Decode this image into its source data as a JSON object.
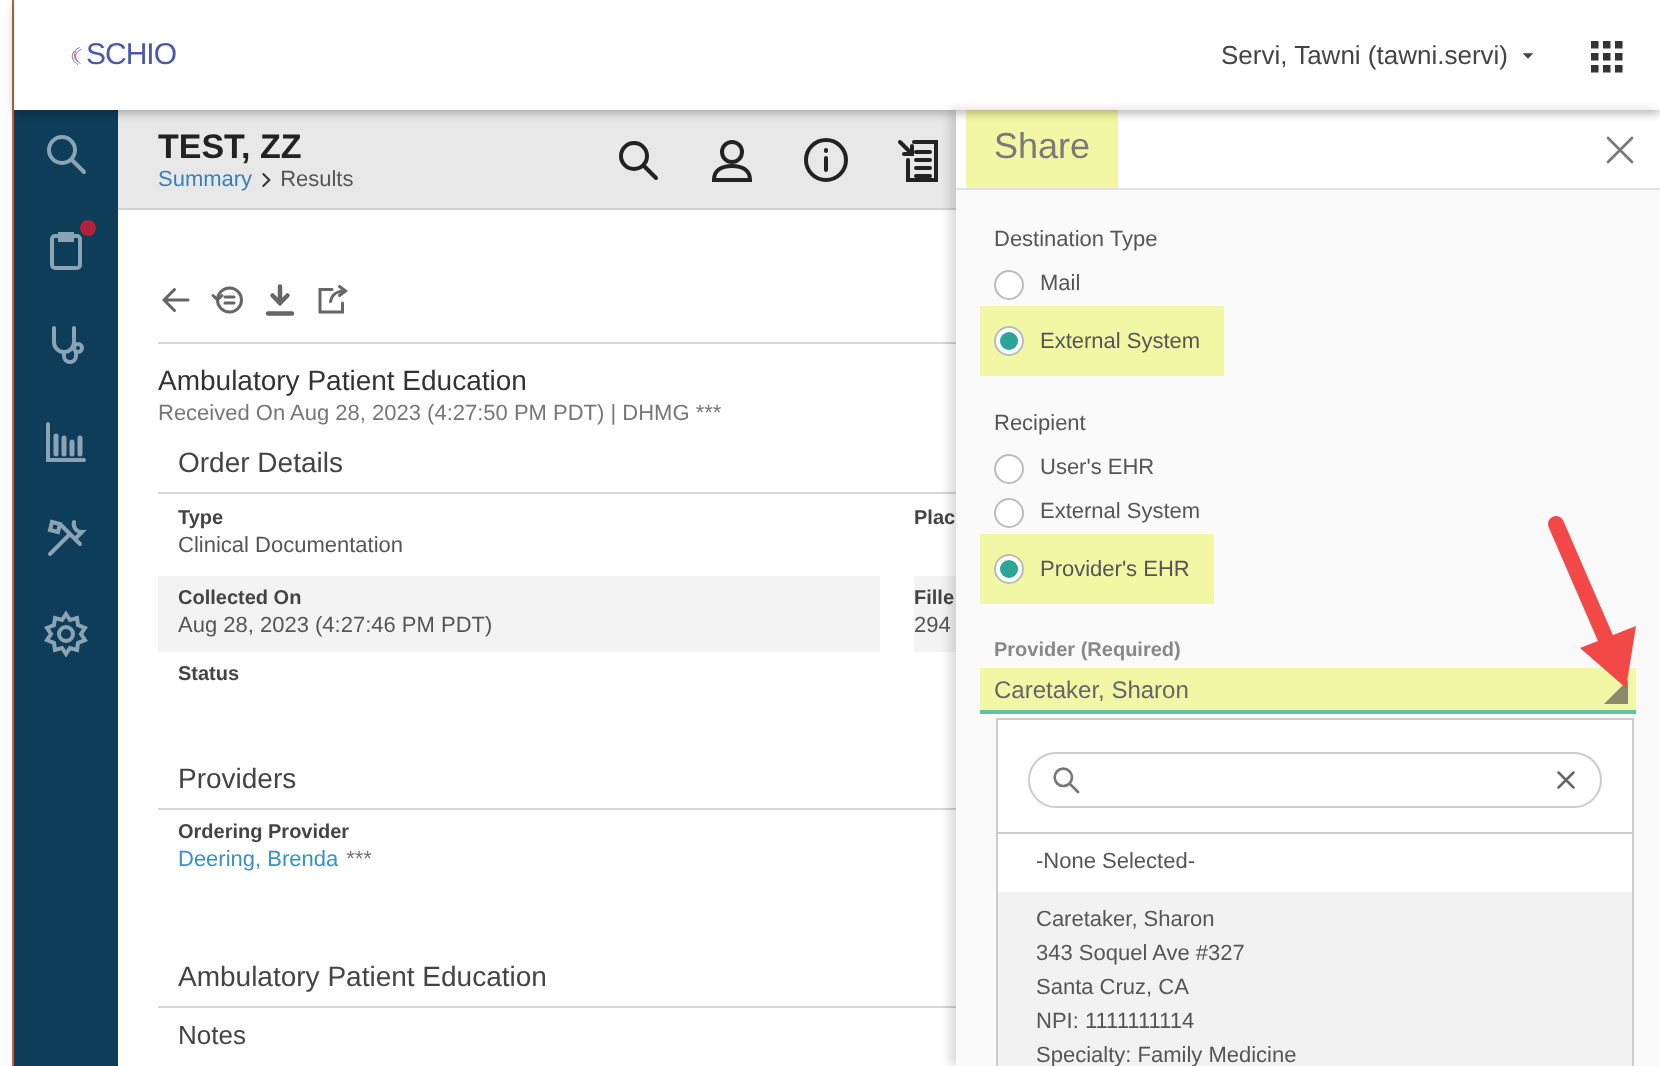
{
  "top_bar": {
    "logo_text": "SCHIO",
    "user": "Servi, Tawni (tawni.servi)"
  },
  "sidebar": {
    "items": [
      {
        "kind": "search",
        "badge": false
      },
      {
        "kind": "clipboard",
        "badge": true
      },
      {
        "kind": "stethoscope",
        "badge": false
      },
      {
        "kind": "chart",
        "badge": false
      },
      {
        "kind": "tools",
        "badge": false
      },
      {
        "kind": "gear",
        "badge": false
      }
    ]
  },
  "header": {
    "patient": "TEST, ZZ",
    "breadcrumb": {
      "link": "Summary",
      "current": "Results"
    },
    "actions": [
      {
        "kind": "search"
      },
      {
        "kind": "person"
      },
      {
        "kind": "info"
      },
      {
        "kind": "import"
      }
    ]
  },
  "document": {
    "toolbar": [
      {
        "kind": "back"
      },
      {
        "kind": "history"
      },
      {
        "kind": "download"
      },
      {
        "kind": "share"
      }
    ],
    "title": "Ambulatory Patient Education",
    "received": "Received On Aug 28, 2023 (4:27:50 PM PDT) | DHMG ***",
    "order_details": {
      "heading": "Order Details",
      "rows": [
        {
          "shaded": false,
          "cells": [
            {
              "label": "Type",
              "value": "Clinical Documentation"
            },
            {
              "label": "Plac"
            }
          ]
        },
        {
          "shaded": true,
          "cells": [
            {
              "label": "Collected On",
              "value": "Aug 28, 2023 (4:27:46 PM PDT)"
            },
            {
              "label": "Fille",
              "value": "294"
            }
          ]
        },
        {
          "shaded": false,
          "cells": [
            {
              "label": "Status"
            }
          ]
        }
      ]
    },
    "providers": {
      "heading": "Providers",
      "label": "Ordering Provider",
      "name": "Deering, Brenda",
      "more": "***"
    },
    "education": {
      "heading": "Ambulatory Patient Education",
      "subheading": "Notes"
    }
  },
  "share_panel": {
    "title": "Share",
    "title_highlighted": true,
    "groups": [
      {
        "label": "Destination Type",
        "options": [
          {
            "label": "Mail",
            "selected": false,
            "highlighted": false
          },
          {
            "label": "External System",
            "selected": true,
            "highlighted": true
          }
        ]
      },
      {
        "label": "Recipient",
        "options": [
          {
            "label": "User's EHR",
            "selected": false,
            "highlighted": false
          },
          {
            "label": "External System",
            "selected": false,
            "highlighted": false
          },
          {
            "label": "Provider's EHR",
            "selected": true,
            "highlighted": true
          }
        ]
      }
    ],
    "provider_field": {
      "label": "Provider (Required)",
      "value": "Caretaker, Sharon",
      "highlighted": true
    },
    "dropdown": {
      "options": [
        {
          "lines": [
            "-None Selected-"
          ],
          "selected": false
        },
        {
          "lines": [
            "Caretaker, Sharon",
            "343 Soquel Ave #327",
            "Santa Cruz, CA",
            "NPI: 1111111114",
            "Specialty: Family Medicine"
          ],
          "selected": true
        }
      ]
    }
  }
}
